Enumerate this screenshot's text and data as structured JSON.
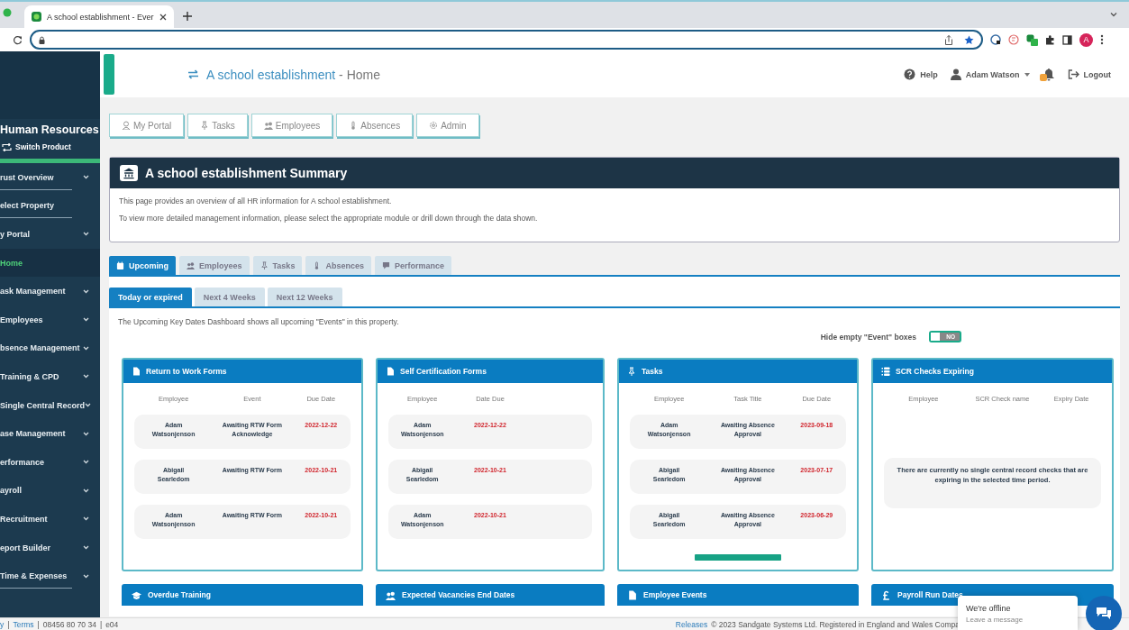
{
  "browser": {
    "tab_title": "A school establishment - Ever",
    "profile_initial": "A"
  },
  "sidebar": {
    "title": "Human Resources",
    "switch_label": "Switch Product",
    "items": [
      {
        "label": "rust Overview",
        "expandable": true,
        "selected": false,
        "divider": true
      },
      {
        "label": "elect Property",
        "expandable": false,
        "selected": false,
        "divider": true
      },
      {
        "label": "y Portal",
        "expandable": true,
        "selected": false,
        "divider": false
      },
      {
        "label": "Home",
        "expandable": false,
        "selected": true,
        "divider": false
      },
      {
        "label": "ask Management",
        "expandable": true,
        "selected": false,
        "divider": false
      },
      {
        "label": "Employees",
        "expandable": true,
        "selected": false,
        "divider": false
      },
      {
        "label": "bsence Management",
        "expandable": true,
        "selected": false,
        "divider": false
      },
      {
        "label": "Training & CPD",
        "expandable": true,
        "selected": false,
        "divider": false
      },
      {
        "label": "Single Central Record",
        "expandable": true,
        "selected": false,
        "divider": false
      },
      {
        "label": "ase Management",
        "expandable": true,
        "selected": false,
        "divider": false
      },
      {
        "label": "erformance",
        "expandable": true,
        "selected": false,
        "divider": false
      },
      {
        "label": "ayroll",
        "expandable": true,
        "selected": false,
        "divider": false
      },
      {
        "label": "Recruitment",
        "expandable": true,
        "selected": false,
        "divider": false
      },
      {
        "label": "eport Builder",
        "expandable": true,
        "selected": false,
        "divider": false
      },
      {
        "label": "Time & Expenses",
        "expandable": true,
        "selected": false,
        "divider": true
      }
    ]
  },
  "header": {
    "establishment": "A school establishment",
    "page": "- Home",
    "help": "Help",
    "user": "Adam Watson",
    "logout": "Logout"
  },
  "module_buttons": [
    "My Portal",
    "Tasks",
    "Employees",
    "Absences",
    "Admin"
  ],
  "summary": {
    "title": "A school establishment Summary",
    "lines": [
      "This page provides an overview of all HR information for A school establishment.",
      "To view more detailed management information, please select the appropriate module or drill down through the data shown."
    ]
  },
  "tabs": [
    {
      "label": "Upcoming",
      "selected": true
    },
    {
      "label": "Employees",
      "selected": false
    },
    {
      "label": "Tasks",
      "selected": false
    },
    {
      "label": "Absences",
      "selected": false
    },
    {
      "label": "Performance",
      "selected": false
    }
  ],
  "subtabs": [
    {
      "label": "Today or expired",
      "selected": true
    },
    {
      "label": "Next 4 Weeks",
      "selected": false
    },
    {
      "label": "Next 12 Weeks",
      "selected": false
    }
  ],
  "intro": "The Upcoming Key Dates Dashboard shows all upcoming \"Events\" in this property.",
  "toggle": {
    "label": "Hide empty \"Event\" boxes",
    "on": false,
    "state_text": "NO"
  },
  "cards": [
    {
      "title": "Return to Work Forms",
      "columns": [
        "Employee",
        "Event",
        "Due Date"
      ],
      "more_bar": false,
      "rows": [
        [
          "Adam Watsonjenson",
          "Awaiting RTW Form Acknowledge",
          "2022-12-22"
        ],
        [
          "Abigail Searledom",
          "Awaiting RTW Form",
          "2022-10-21"
        ],
        [
          "Adam Watsonjenson",
          "Awaiting RTW Form",
          "2022-10-21"
        ]
      ]
    },
    {
      "title": "Self Certification Forms",
      "columns": [
        "Employee",
        "Date Due"
      ],
      "more_bar": false,
      "rows": [
        [
          "Adam Watsonjenson",
          "2022-12-22"
        ],
        [
          "Abigail Searledom",
          "2022-10-21"
        ],
        [
          "Adam Watsonjenson",
          "2022-10-21"
        ]
      ]
    },
    {
      "title": "Tasks",
      "columns": [
        "Employee",
        "Task Title",
        "Due Date"
      ],
      "more_bar": true,
      "rows": [
        [
          "Adam Watsonjenson",
          "Awaiting Absence Approval",
          "2023-09-18"
        ],
        [
          "Abigail Searledom",
          "Awaiting Absence Approval",
          "2023-07-17"
        ],
        [
          "Abigail Searledom",
          "Awaiting Absence Approval",
          "2023-06-29"
        ]
      ]
    },
    {
      "title": "SCR Checks Expiring",
      "columns": [
        "Employee",
        "SCR Check name",
        "Expiry Date"
      ],
      "more_bar": false,
      "empty_message": "There are currently no single central record checks that are expiring in the selected time period."
    }
  ],
  "bottom_cards": [
    "Overdue Training",
    "Expected Vacancies End Dates",
    "Employee Events",
    "Payroll Run Dates"
  ],
  "footer": {
    "left": [
      {
        "kind": "link",
        "text": "y"
      },
      {
        "kind": "sep",
        "text": "|"
      },
      {
        "kind": "link",
        "text": "Terms"
      },
      {
        "kind": "sep",
        "text": "|"
      },
      {
        "kind": "text",
        "text": "08456 80 70 34"
      },
      {
        "kind": "sep",
        "text": "|"
      },
      {
        "kind": "text",
        "text": "e04"
      }
    ],
    "releases": "Releases",
    "copyright": "© 2023 Sandgate Systems Ltd. Registered in England and Wales Compa"
  },
  "chat": {
    "status": "We're offline",
    "prompt": "Leave a message"
  }
}
